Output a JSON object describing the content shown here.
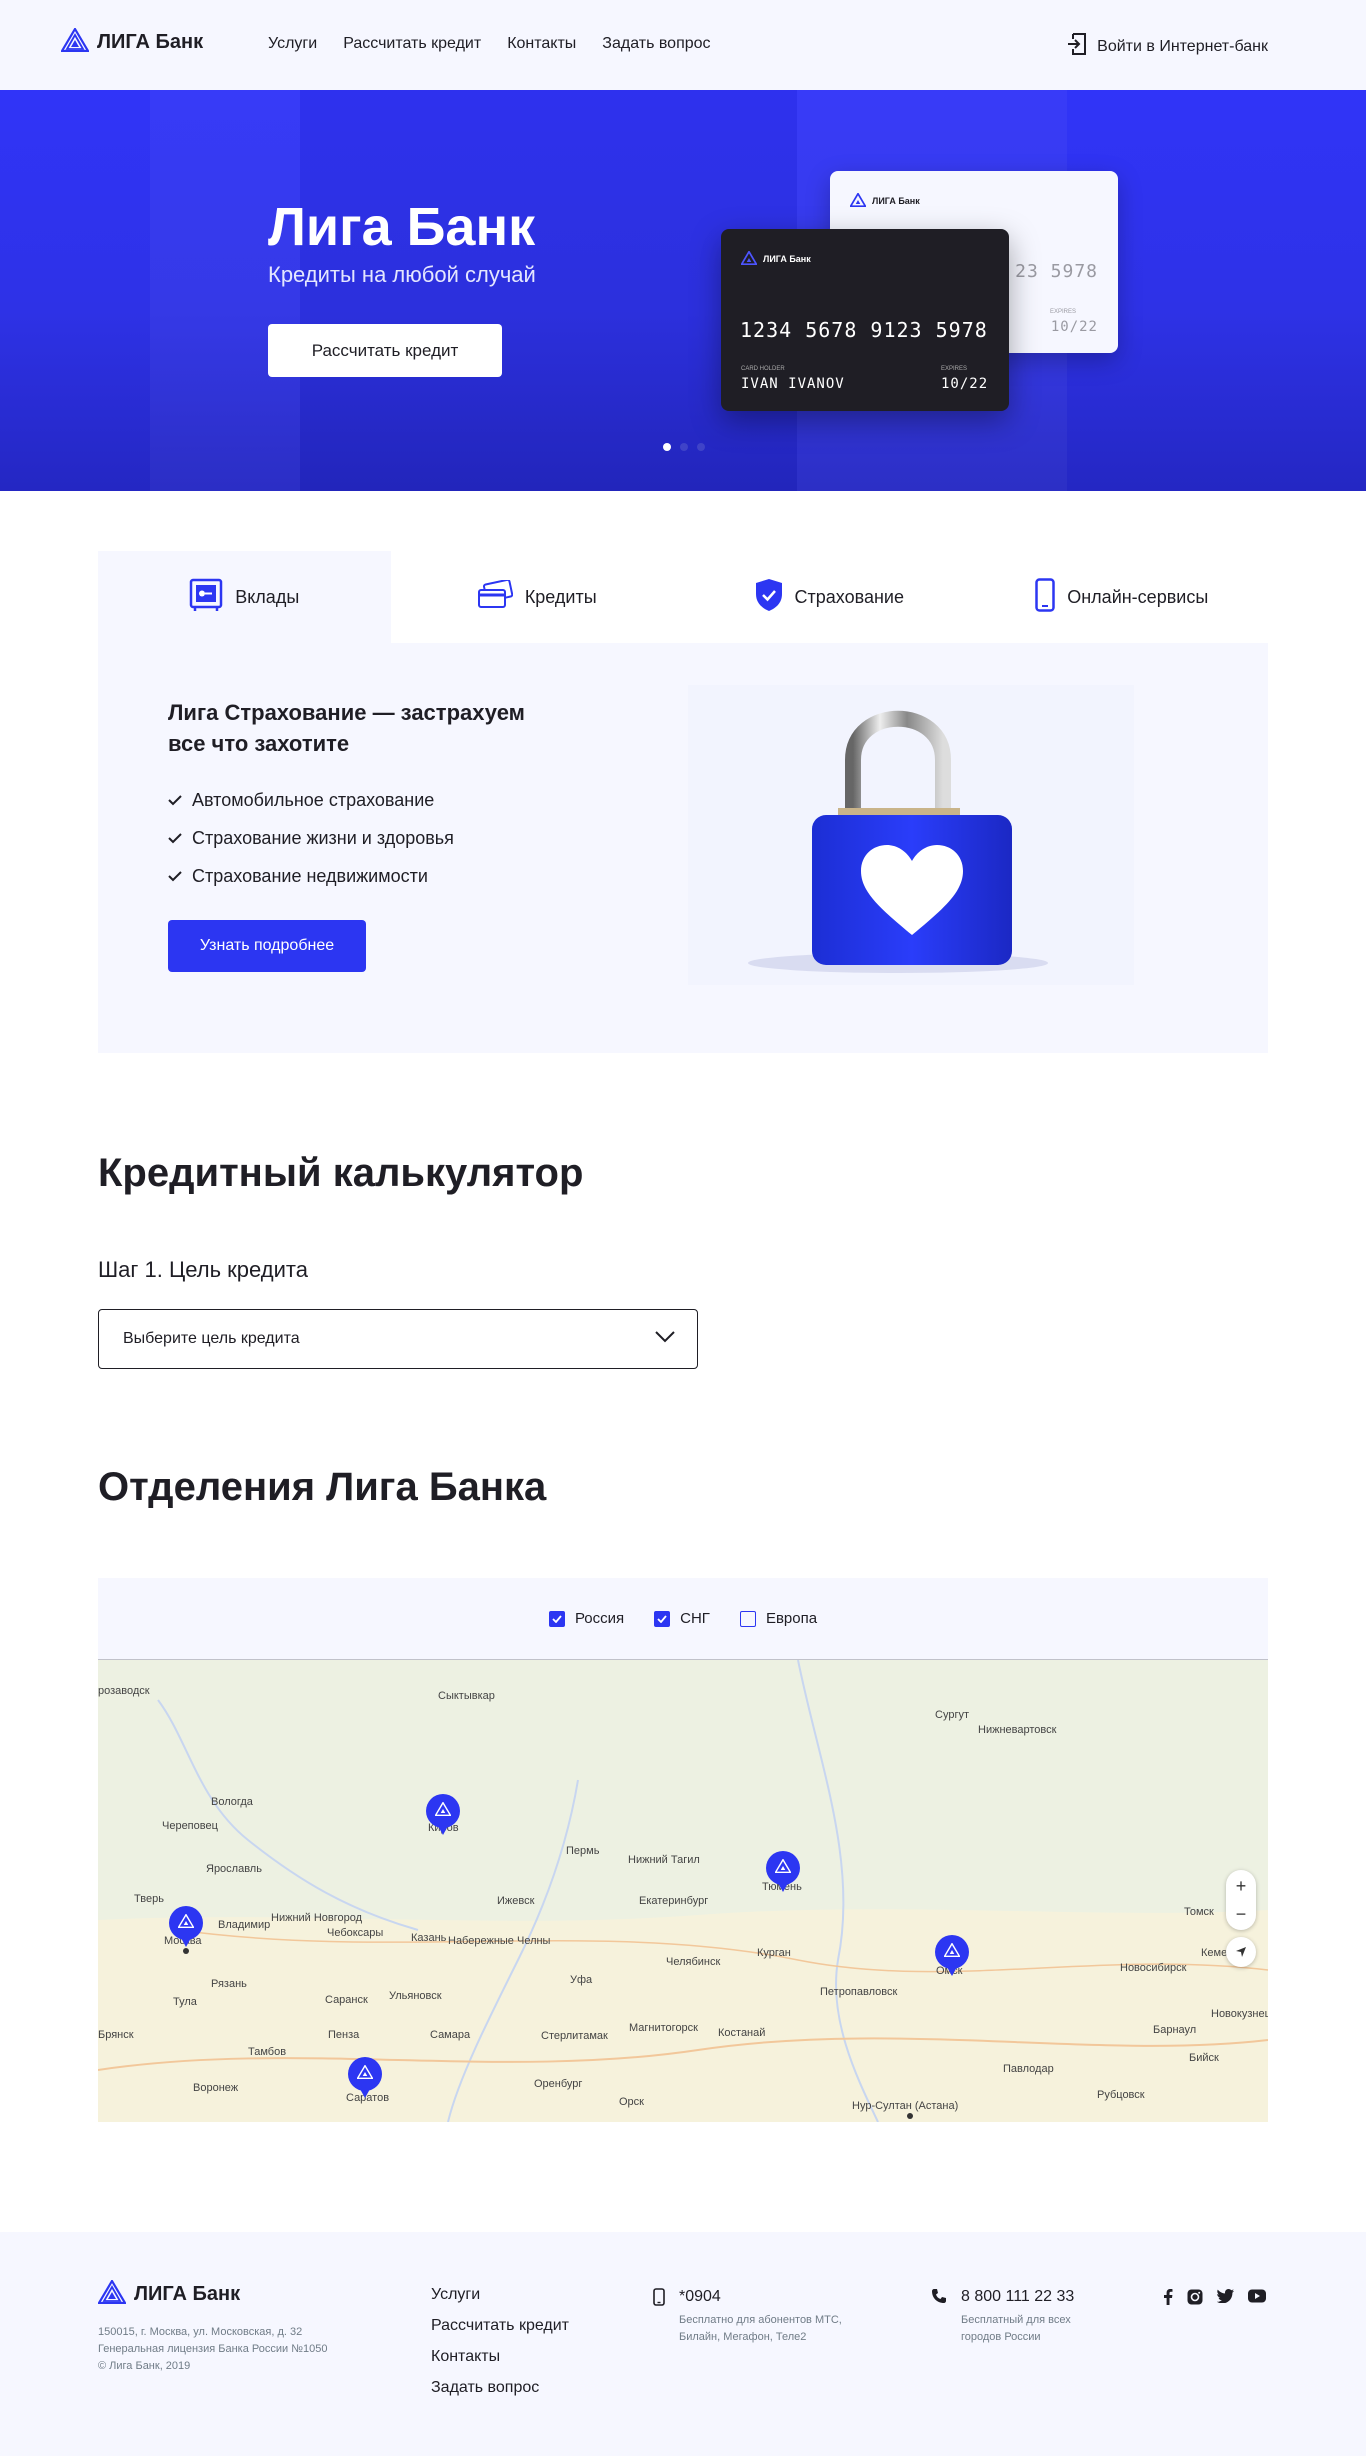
{
  "header": {
    "logo_text": "ЛИГА Банк",
    "nav": [
      "Услуги",
      "Рассчитать кредит",
      "Контакты",
      "Задать вопрос"
    ],
    "login_label": "Войти в Интернет-банк"
  },
  "hero": {
    "title": "Лига Банк",
    "subtitle": "Кредиты на любой случай",
    "button_label": "Рассчитать кредит",
    "slides_count": 3,
    "active_slide": 1,
    "card_front": {
      "brand": "ЛИГА Банк",
      "number": "1234 5678 9123 5978",
      "holder_label": "CARD HOLDER",
      "holder": "IVAN IVANOV",
      "expires_label": "EXPIRES",
      "expires": "10/22"
    },
    "card_back": {
      "brand": "ЛИГА Банк",
      "number_tail": "23 5978",
      "expires_label": "EXPIRES",
      "expires": "10/22"
    }
  },
  "services": {
    "tabs": [
      "Вклады",
      "Кредиты",
      "Страхование",
      "Онлайн-сервисы"
    ],
    "active_tab": 0,
    "title": "Лига Страхование — застрахуем все что захотите",
    "items": [
      "Автомобильное страхование",
      "Страхование жизни и здоровья",
      "Страхование недвижимости"
    ],
    "button_label": "Узнать подробнее"
  },
  "calculator": {
    "title": "Кредитный калькулятор",
    "step_label": "Шаг 1. Цель кредита",
    "select_placeholder": "Выберите цель кредита"
  },
  "branches": {
    "title": "Отделения Лига Банка",
    "filters": [
      {
        "label": "Россия",
        "checked": true
      },
      {
        "label": "СНГ",
        "checked": true
      },
      {
        "label": "Европа",
        "checked": false
      }
    ],
    "map_labels": [
      "розаводск",
      "Сыктывкар",
      "Сургут",
      "Нижневартовск",
      "Вологда",
      "Череповец",
      "Киров",
      "Пермь",
      "Ярославль",
      "Тверь",
      "Москва",
      "Владимир",
      "Нижний Новгород",
      "Чебоксары",
      "Ижевск",
      "Нижний Тагил",
      "Екатеринбург",
      "Тюмень",
      "Казань",
      "Набережные Челны",
      "Тула",
      "Рязань",
      "Саранск",
      "Ульяновск",
      "Уфа",
      "Челябинск",
      "Курган",
      "Петропавловск",
      "Омск",
      "Новосибирск",
      "Томск",
      "Кемерово",
      "Брянск",
      "Пенза",
      "Самара",
      "Стерлитамак",
      "Магнитогорск",
      "Костанай",
      "Барнаул",
      "Бийск",
      "Новокузнецк",
      "Тамбов",
      "Саратов",
      "Оренбург",
      "Орск",
      "Павлодар",
      "Рубцовск",
      "Воронеж",
      "Нур-Султан (Астана)"
    ],
    "zoom_in": "+",
    "zoom_out": "−"
  },
  "footer": {
    "logo_text": "ЛИГА Банк",
    "address": "150015, г. Москва, ул. Московская, д. 32",
    "license": "Генеральная лицензия Банка России №1050",
    "copyright": "© Лига Банк, 2019",
    "nav": [
      "Услуги",
      "Рассчитать кредит",
      "Контакты",
      "Задать вопрос"
    ],
    "mobile_number": "*0904",
    "mobile_desc": "Бесплатно для абонентов МТС, Билайн, Мегафон, Теле2",
    "phone_number": "8 800 111 22 33",
    "phone_desc": "Бесплатный для всех городов России",
    "social": [
      "facebook-icon",
      "instagram-icon",
      "twitter-icon",
      "youtube-icon"
    ]
  },
  "colors": {
    "brand_blue": "#2c36f2",
    "dark": "#1f1e25",
    "light_bg": "#f6f7ff"
  }
}
